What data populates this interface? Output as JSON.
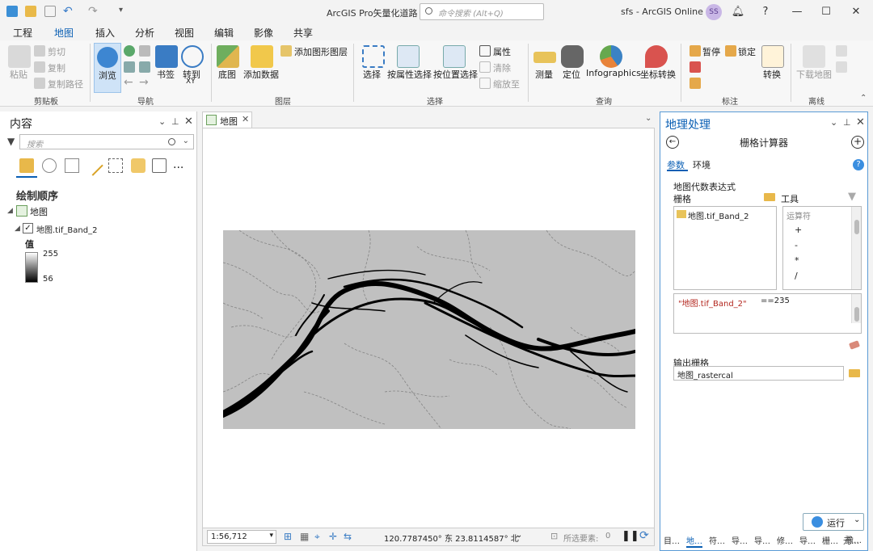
{
  "titlebar": {
    "app_title": "ArcGIS Pro矢量化道路",
    "search_placeholder": "命令搜索 (Alt+Q)",
    "account": "sfs - ArcGIS Online",
    "avatar": "SS",
    "help": "?",
    "minimize": "—",
    "maximize": "☐",
    "close": "✕"
  },
  "tabs": [
    "工程",
    "地图",
    "插入",
    "分析",
    "视图",
    "编辑",
    "影像",
    "共享"
  ],
  "ribbon": {
    "clipboard": {
      "paste": "粘贴",
      "cut": "剪切",
      "copy": "复制",
      "copy_path": "复制路径",
      "label": "剪贴板"
    },
    "navigate": {
      "explore": "浏览",
      "bookmarks": "书签",
      "goto": "转到",
      "goto_sub": "XY",
      "label": "导航"
    },
    "layer": {
      "basemap": "底图",
      "add_data": "添加数据",
      "add_graphics": "添加图形图层",
      "label": "图层"
    },
    "selection": {
      "select": "选择",
      "by_attr": "按属性选择",
      "by_loc": "按位置选择",
      "attributes": "属性",
      "clear": "清除",
      "zoom_to": "缩放至",
      "label": "选择"
    },
    "inquiry": {
      "measure": "测量",
      "locate": "定位",
      "infographics": "Infographics",
      "convert": "坐标转换",
      "label": "查询"
    },
    "labeling": {
      "pause": "暂停",
      "lock": "锁定",
      "convert": "转换",
      "label": "标注"
    },
    "offline": {
      "download": "下载地图",
      "label": "离线"
    }
  },
  "contents": {
    "title": "内容",
    "search_placeholder": "搜索",
    "drawing_order": "绘制顺序",
    "map_name": "地图",
    "layer_name": "地图.tif_Band_2",
    "legend_title": "值",
    "legend_high": "255",
    "legend_low": "56",
    "more": "..."
  },
  "map": {
    "tab_label": "地图",
    "scale": "1:56,712",
    "coords": "120.7787450° 东  23.8114587° 北",
    "selected_label": "所选要素:",
    "selected_count": "0"
  },
  "geoprocessing": {
    "title": "地理处理",
    "tool_title": "栅格计算器",
    "tab_params": "参数",
    "tab_env": "环境",
    "map_algebra": "地图代数表达式",
    "rasters_label": "栅格",
    "tools_label": "工具",
    "raster_item": "地图.tif_Band_2",
    "operators_label": "运算符",
    "operators": [
      "+",
      "-",
      "*",
      "/"
    ],
    "expr_part1": "\"地图.tif_Band_2\"",
    "expr_part2": "==235",
    "output_label": "输出栅格",
    "output_value": "地图_rastercal",
    "run": "运行",
    "bottom_tabs": [
      "目…",
      "地…",
      "符…",
      "导…",
      "导…",
      "修…",
      "导…",
      "栅…",
      "元…",
      "豫…"
    ]
  },
  "colors": {
    "accent": "#0a5fb4",
    "raster_bg": "#c0c0c0",
    "road": "#000000"
  }
}
